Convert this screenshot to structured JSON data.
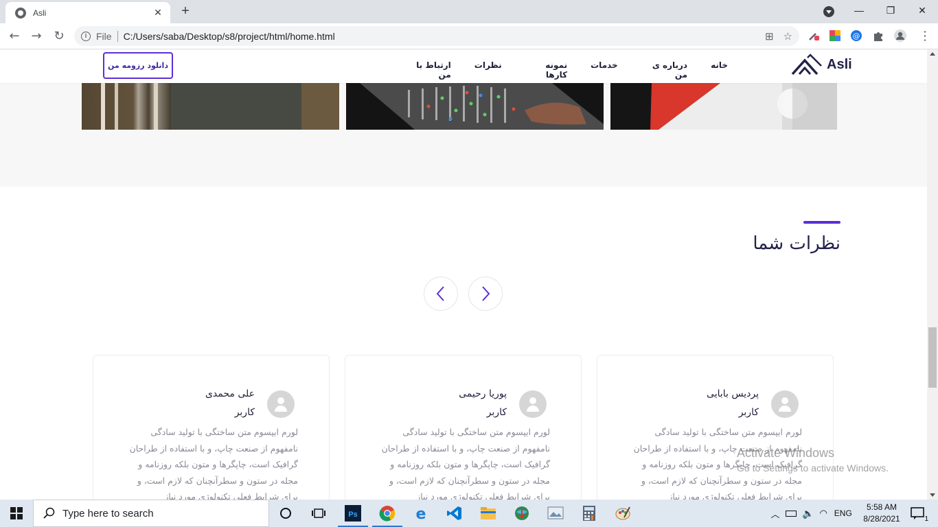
{
  "browser": {
    "tab_title": "Asli",
    "tab_close": "✕",
    "new_tab": "+",
    "scheme": "File",
    "url": "C:/Users/saba/Desktop/s8/project/html/home.html",
    "window_minimize": "—",
    "window_restore": "❐",
    "window_close": "✕"
  },
  "site": {
    "logo_text": "Asli",
    "download_button": "دانلود رزومه من",
    "menu": [
      "خانه",
      "درباره ی من",
      "خدمات",
      "نمونه کارها",
      "نظرات",
      "ارتباط با من"
    ],
    "accent_color": "#5a2fd6"
  },
  "testimonials": {
    "title": "نظرات شما",
    "cards": [
      {
        "name": "پردیس بابایی",
        "role": "کاربر",
        "text": "لورم ایپسوم متن ساختگی با تولید سادگی نامفهوم از صنعت چاپ، و با استفاده از طراحان گرافیک است، چاپگرها و متون بلکه روزنامه و مجله در ستون و سطرآنچنان که لازم است، و برای شرایط فعلی تکنولوژی مورد نیاز"
      },
      {
        "name": "پوریا رحیمی",
        "role": "کاربر",
        "text": "لورم ایپسوم متن ساختگی با تولید سادگی نامفهوم از صنعت چاپ، و با استفاده از طراحان گرافیک است، چاپگرها و متون بلکه روزنامه و مجله در ستون و سطرآنچنان که لازم است، و برای شرایط فعلی تکنولوژی مورد نیاز"
      },
      {
        "name": "علی محمدی",
        "role": "کاربر",
        "text": "لورم ایپسوم متن ساختگی با تولید سادگی نامفهوم از صنعت چاپ، و با استفاده از طراحان گرافیک است، چاپگرها و متون بلکه روزنامه و مجله در ستون و سطرآنچنان که لازم است، و برای شرایط فعلی تکنولوژی مورد نیاز"
      }
    ]
  },
  "watermark": {
    "line1": "Activate Windows",
    "line2": "Go to Settings to activate Windows."
  },
  "taskbar": {
    "search_placeholder": "Type here to search",
    "language": "ENG",
    "time": "5:58 AM",
    "date": "8/28/2021",
    "notification_count": "1"
  }
}
